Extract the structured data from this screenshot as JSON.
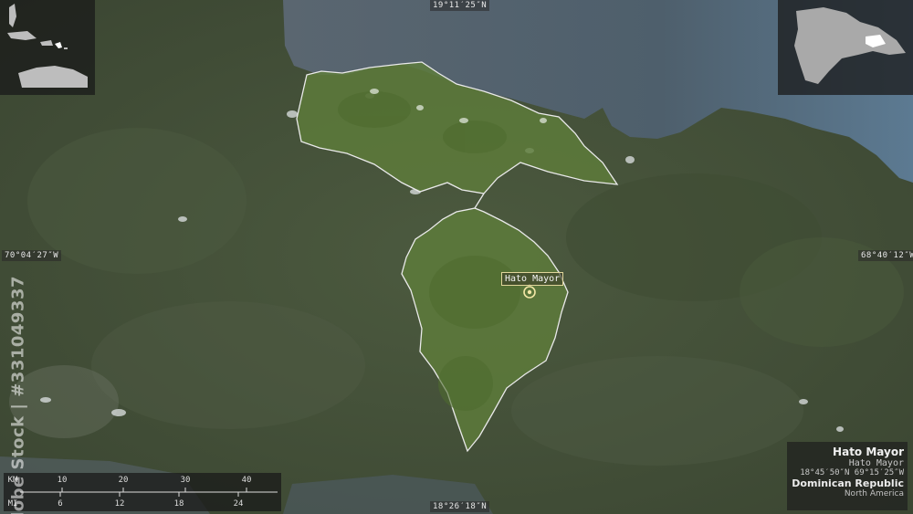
{
  "coords": {
    "top": "19°11′25″N",
    "bottom": "18°26′18″N",
    "left": "70°04′27″W",
    "right": "68°40′12″W"
  },
  "city": {
    "label": "Hato Mayor"
  },
  "info": {
    "region": "Hato Mayor",
    "region_sub": "Hato Mayor",
    "coordinates": "18°45′50″N 69°15′25″W",
    "country": "Dominican Republic",
    "continent": "North America"
  },
  "scale": {
    "km_unit": "KM",
    "mi_unit": "MI",
    "km_ticks": [
      "10",
      "20",
      "30",
      "40"
    ],
    "mi_ticks": [
      "6",
      "12",
      "18",
      "24"
    ]
  },
  "watermark": "Adobe Stock | #331049337",
  "colors": {
    "land": "#46543c",
    "water": "#4a5a66",
    "highlight": "#5e7c3a",
    "border": "#eaeaea"
  }
}
